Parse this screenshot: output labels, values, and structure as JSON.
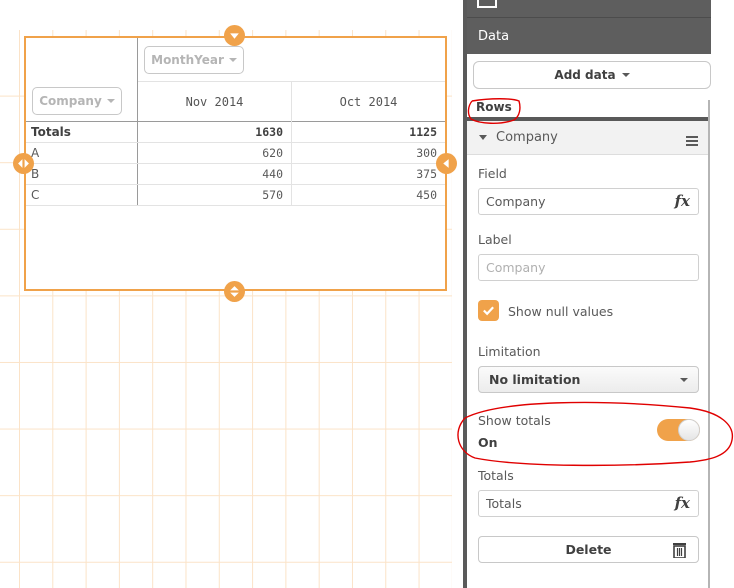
{
  "table": {
    "dimension_buttons": {
      "row_dimension": "Company",
      "column_dimension": "MonthYear"
    },
    "columns": [
      "Nov 2014",
      "Oct 2014"
    ],
    "rows": [
      {
        "label": "Totals",
        "values": [
          "1630",
          "1125"
        ],
        "is_total": true
      },
      {
        "label": "A",
        "values": [
          "620",
          "300"
        ],
        "is_total": false
      },
      {
        "label": "B",
        "values": [
          "440",
          "375"
        ],
        "is_total": false
      },
      {
        "label": "C",
        "values": [
          "570",
          "450"
        ],
        "is_total": false
      }
    ]
  },
  "panel": {
    "section_title": "Data",
    "add_data_label": "Add data",
    "rows_label": "Rows",
    "dimension_item": "Company",
    "field": {
      "label": "Field",
      "value": "Company",
      "fx_icon": "fx"
    },
    "label_field": {
      "label": "Label",
      "placeholder": "Company"
    },
    "show_null_values": {
      "label": "Show null values",
      "checked": true
    },
    "limitation": {
      "label": "Limitation",
      "selected": "No limitation"
    },
    "show_totals": {
      "label": "Show totals",
      "state_text": "On",
      "enabled": true
    },
    "totals": {
      "label": "Totals",
      "value": "Totals",
      "fx_icon": "fx"
    },
    "delete_label": "Delete"
  },
  "colors": {
    "accent": "#f0a24a",
    "panel_header": "#5e5e5e",
    "annotation": "#e00000"
  }
}
